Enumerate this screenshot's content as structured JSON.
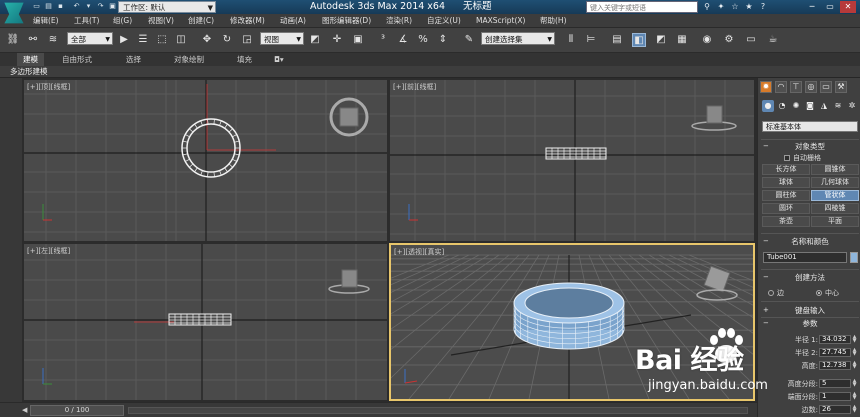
{
  "titlebar": {
    "workspace_label": "工作区: 默认",
    "app_title": "Autodesk 3ds Max  2014 x64",
    "document_title": "无标题",
    "search_placeholder": "键入关键字或短语"
  },
  "menu": [
    {
      "label": "编辑(E)"
    },
    {
      "label": "工具(T)"
    },
    {
      "label": "组(G)"
    },
    {
      "label": "视图(V)"
    },
    {
      "label": "创建(C)"
    },
    {
      "label": "修改器(M)"
    },
    {
      "label": "动画(A)"
    },
    {
      "label": "图形编辑器(D)"
    },
    {
      "label": "渲染(R)"
    },
    {
      "label": "自定义(U)"
    },
    {
      "label": "MAXScript(X)"
    },
    {
      "label": "帮助(H)"
    }
  ],
  "toolbar": {
    "selection_filter": "全部",
    "ref_coord": "视图",
    "named_selection": "创建选择集"
  },
  "ribbon": {
    "tabs": [
      {
        "label": "建模"
      },
      {
        "label": "自由形式"
      },
      {
        "label": "选择"
      },
      {
        "label": "对象绘制"
      },
      {
        "label": "填充"
      }
    ],
    "sub_label": "多边形建模"
  },
  "viewports": {
    "top": "[+][顶][线框]",
    "front": "[+][前][线框]",
    "left": "[+][左][线框]",
    "perspective": "[+][透视][真实]"
  },
  "command_panel": {
    "category": "标准基本体",
    "object_type_title": "对象类型",
    "autogrid": "自动栅格",
    "buttons": [
      {
        "label": "长方体"
      },
      {
        "label": "圆锥体"
      },
      {
        "label": "球体"
      },
      {
        "label": "几何球体"
      },
      {
        "label": "圆柱体"
      },
      {
        "label": "管状体",
        "active": true
      },
      {
        "label": "圆环"
      },
      {
        "label": "四棱锥"
      },
      {
        "label": "茶壶"
      },
      {
        "label": "平面"
      }
    ],
    "name_color_title": "名称和颜色",
    "object_name": "Tube001",
    "object_color": "#8fb6dc",
    "creation_method_title": "创建方法",
    "creation_methods": [
      {
        "label": "边",
        "selected": false
      },
      {
        "label": "中心",
        "selected": true
      }
    ],
    "keyboard_entry_title": "键盘输入",
    "parameters_title": "参数",
    "parameters": [
      {
        "label": "半径 1:",
        "value": "34.032"
      },
      {
        "label": "半径 2:",
        "value": "27.745"
      },
      {
        "label": "高度:",
        "value": "12.738"
      },
      {
        "label": "高度分段:",
        "value": "5"
      },
      {
        "label": "端面分段:",
        "value": "1"
      },
      {
        "label": "边数:",
        "value": "26"
      }
    ]
  },
  "statusbar": {
    "time_slider": "0 / 100"
  },
  "watermark": {
    "brand": "Bai 经验",
    "url": "jingyan.baidu.com"
  },
  "colors": {
    "accent": "#5f87b3",
    "active_viewport_border": "#e8c66b",
    "create_tab": "#d77b2a",
    "tube_color": "#8fb6dc"
  }
}
